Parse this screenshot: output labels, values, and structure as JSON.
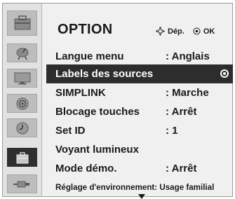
{
  "header": {
    "title": "OPTION",
    "hint_move": "Dép.",
    "hint_ok": "OK"
  },
  "sidebar": {
    "items": [
      {
        "icon": "setup-icon",
        "active": false
      },
      {
        "icon": "satellite-dish-icon",
        "active": false
      },
      {
        "icon": "picture-monitor-icon",
        "active": false
      },
      {
        "icon": "audio-speaker-icon",
        "active": false
      },
      {
        "icon": "clock-icon",
        "active": false
      },
      {
        "icon": "option-toolbox-icon",
        "active": true
      },
      {
        "icon": "input-plug-icon",
        "active": false
      }
    ]
  },
  "menu": {
    "items": [
      {
        "label": "Langue menu",
        "value": ": Anglais"
      },
      {
        "label": "Labels des sources",
        "value": ""
      },
      {
        "label": "SIMPLINK",
        "value": ": Marche"
      },
      {
        "label": "Blocage touches",
        "value": ": Arrêt"
      },
      {
        "label": "Set ID",
        "value": ": 1"
      },
      {
        "label": "Voyant lumineux",
        "value": ""
      },
      {
        "label": "Mode démo.",
        "value": ": Arrêt"
      },
      {
        "label": "Réglage d'environnement",
        "value": ": Usage familial"
      }
    ],
    "selected_index": 1
  },
  "colors": {
    "panel_bg": "#f0f0f0",
    "sidebar_bg": "#e2e2e2",
    "tile_bg": "#bdbdbd",
    "selected_bg": "#2d2d2d",
    "text": "#1a1a1a"
  }
}
